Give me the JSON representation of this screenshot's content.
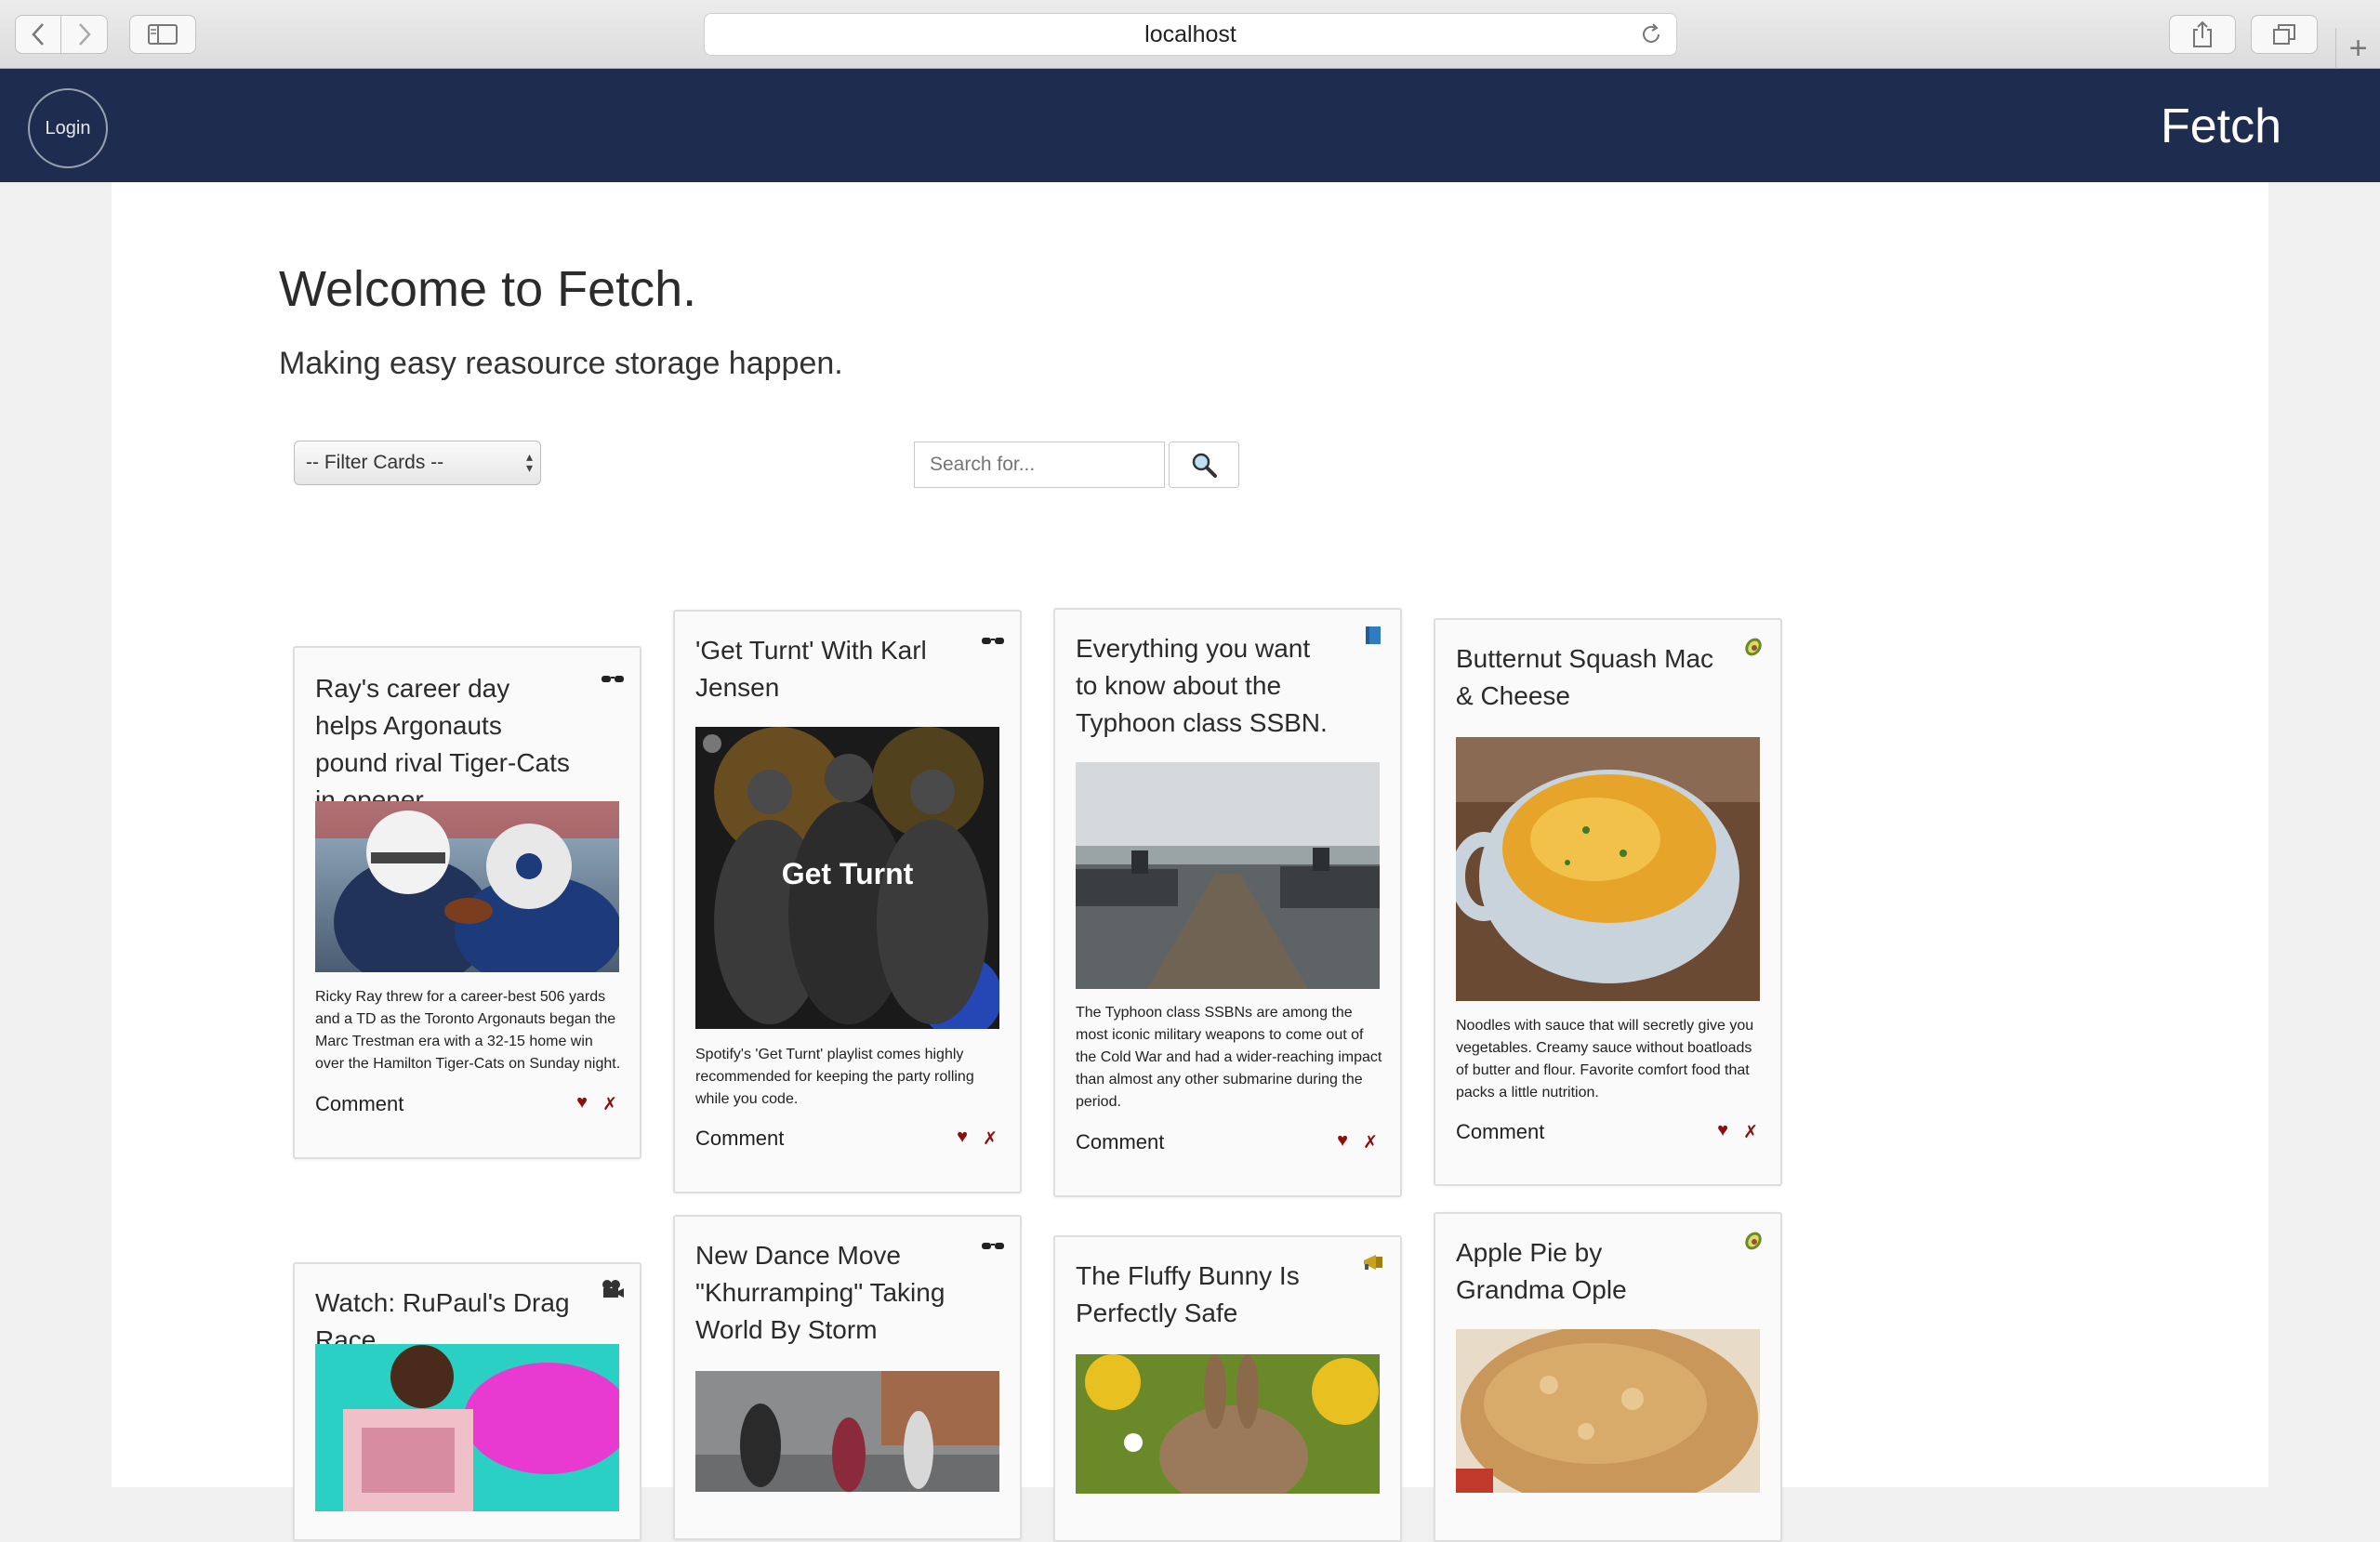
{
  "browser": {
    "url": "localhost"
  },
  "header": {
    "login_label": "Login",
    "brand": "Fetch",
    "bg_color": "#1e2d4f"
  },
  "hero": {
    "title": "Welcome to Fetch.",
    "subtitle": "Making easy reasource storage happen."
  },
  "controls": {
    "filter_selected": "-- Filter Cards --",
    "search_placeholder": "Search for..."
  },
  "cards": [
    {
      "title": "Ray's career day helps Argonauts pound rival Tiger-Cats in opener",
      "icon": "sunglasses-icon",
      "description": "Ricky Ray threw for a career-best 506 yards and a TD as the Toronto Argonauts began the Marc Trestman era with a 32-15 home win over the Hamilton Tiger-Cats on Sunday night.",
      "comment_label": "Comment",
      "like_glyph": "♥",
      "remove_glyph": "✗"
    },
    {
      "title": "'Get Turnt' With Karl Jensen",
      "icon": "sunglasses-icon",
      "image_text": "Get Turnt",
      "description": "Spotify's 'Get Turnt' playlist comes highly recommended for keeping the party rolling while you code.",
      "comment_label": "Comment",
      "like_glyph": "♥",
      "remove_glyph": "✗"
    },
    {
      "title": "Everything you want to know about the Typhoon class SSBN.",
      "icon": "book-icon",
      "description": "The Typhoon class SSBNs are among the most iconic military weapons to come out of the Cold War and had a wider-reaching impact than almost any other submarine during the period.",
      "comment_label": "Comment",
      "like_glyph": "♥",
      "remove_glyph": "✗"
    },
    {
      "title": "Butternut Squash Mac & Cheese",
      "icon": "avocado-icon",
      "description": "Noodles with sauce that will secretly give you vegetables. Creamy sauce without boatloads of butter and flour. Favorite comfort food that packs a little nutrition.",
      "comment_label": "Comment",
      "like_glyph": "♥",
      "remove_glyph": "✗"
    },
    {
      "title": "Watch: RuPaul's Drag Race",
      "icon": "movie-camera-icon"
    },
    {
      "title": "New Dance Move \"Khurramping\" Taking World By Storm",
      "icon": "sunglasses-icon"
    },
    {
      "title": "The Fluffy Bunny Is Perfectly Safe",
      "icon": "megaphone-icon"
    },
    {
      "title": "Apple Pie by Grandma Ople",
      "icon": "avocado-icon"
    }
  ]
}
